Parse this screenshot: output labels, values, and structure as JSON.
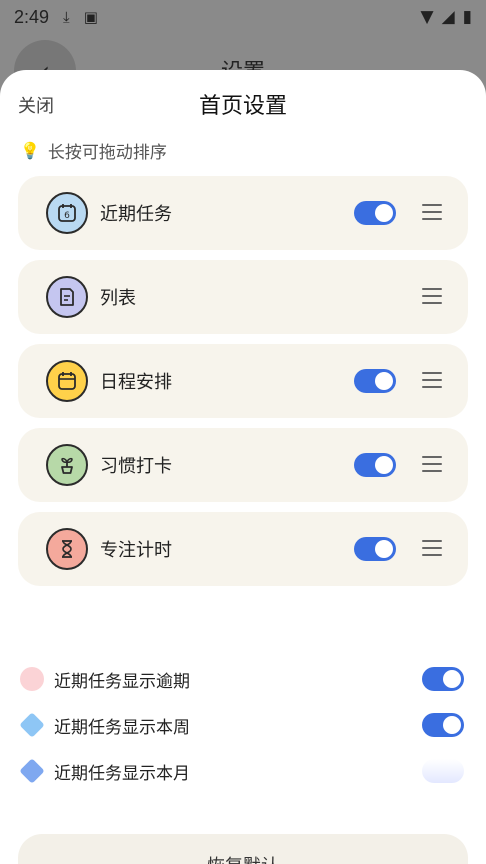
{
  "status_bar": {
    "time": "2:49",
    "icons": [
      "download-icon",
      "a-box-icon",
      "wifi-icon",
      "signal-icon",
      "battery-icon"
    ]
  },
  "background_page": {
    "title": "设置",
    "back_icon": "back-arrow-icon"
  },
  "sheet": {
    "close_label": "关闭",
    "title": "首页设置",
    "hint": "长按可拖动排序",
    "hint_icon": "lightbulb-icon"
  },
  "modules": [
    {
      "label": "近期任务",
      "icon": "calendar-6-icon",
      "icon_color": "#b9d9f2",
      "toggle": true
    },
    {
      "label": "列表",
      "icon": "document-icon",
      "icon_color": "#c5c6f0",
      "toggle": null
    },
    {
      "label": "日程安排",
      "icon": "calendar-icon",
      "icon_color": "#ffd14a",
      "toggle": true
    },
    {
      "label": "习惯打卡",
      "icon": "sprout-icon",
      "icon_color": "#b7d9a8",
      "toggle": true
    },
    {
      "label": "专注计时",
      "icon": "hourglass-icon",
      "icon_color": "#f4a99c",
      "toggle": true
    }
  ],
  "options": [
    {
      "label": "近期任务显示逾期",
      "dot": "circle",
      "dot_color": "#fbd3d6",
      "on": true
    },
    {
      "label": "近期任务显示本周",
      "dot": "diamond",
      "dot_color": "#8ec6f5",
      "on": true
    },
    {
      "label": "近期任务显示本月",
      "dot": "diamond",
      "dot_color": "#7fa8f0",
      "on": false
    }
  ],
  "bottom_button": "恢复默认",
  "colors": {
    "accent": "#3a6ee0",
    "card_bg": "#f7f4ec",
    "sheet_bg": "#ffffff"
  }
}
